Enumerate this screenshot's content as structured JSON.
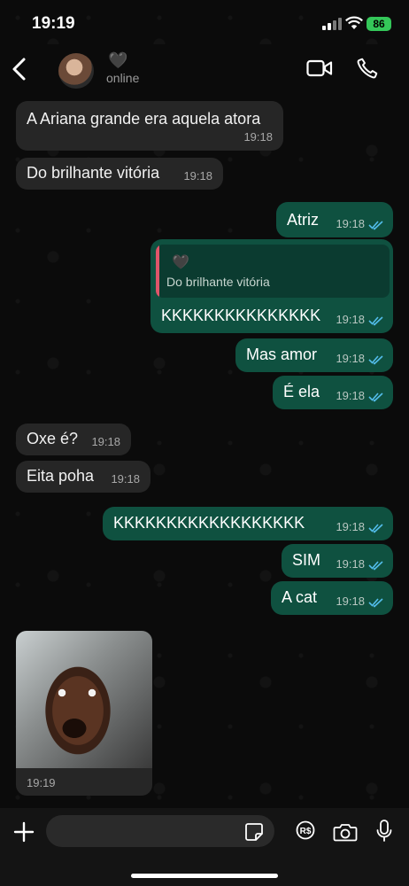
{
  "status_bar": {
    "time": "19:19",
    "battery": "86"
  },
  "header": {
    "contact_name": "🖤",
    "contact_status": "online"
  },
  "messages": [
    {
      "dir": "in",
      "text": "A Ariana grande era aquela atora",
      "time": "19:18"
    },
    {
      "dir": "in",
      "text": "Do brilhante vitória",
      "time": "19:18"
    },
    {
      "dir": "out",
      "text": "Atriz",
      "time": "19:18"
    },
    {
      "dir": "out",
      "text": "KKKKKKKKKKKKKKK",
      "time": "19:18",
      "quote": {
        "author": "🖤",
        "text": "Do brilhante vitória"
      }
    },
    {
      "dir": "out",
      "text": "Mas amor",
      "time": "19:18"
    },
    {
      "dir": "out",
      "text": "É ela",
      "time": "19:18"
    },
    {
      "dir": "in",
      "text": "Oxe é?",
      "time": "19:18"
    },
    {
      "dir": "in",
      "text": "Eita poha",
      "time": "19:18"
    },
    {
      "dir": "out",
      "text": "KKKKKKKKKKKKKKKKKK",
      "time": "19:18"
    },
    {
      "dir": "out",
      "text": "SIM",
      "time": "19:18"
    },
    {
      "dir": "out",
      "text": "A cat",
      "time": "19:18"
    }
  ],
  "photo_message": {
    "time": "19:19"
  },
  "input": {
    "placeholder": ""
  },
  "colors": {
    "outgoing_bubble": "#0f5140",
    "incoming_bubble": "#262626",
    "read_ticks": "#53bdeb",
    "accent": "#34c759"
  }
}
